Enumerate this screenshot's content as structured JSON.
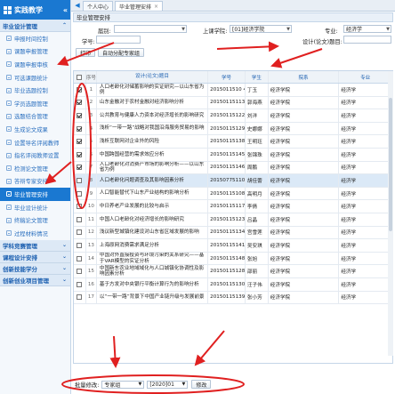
{
  "sidebar": {
    "app_title": "实践教学",
    "sections": [
      {
        "label": "毕业设计管理"
      },
      {
        "label": "学科竞赛管理"
      },
      {
        "label": "课程设计安排"
      },
      {
        "label": "创新技能学分"
      },
      {
        "label": "创新创业项目管理"
      }
    ],
    "items": [
      {
        "label": "申报时间控制"
      },
      {
        "label": "课题申报管理"
      },
      {
        "label": "课题申报审核"
      },
      {
        "label": "可选课题统计"
      },
      {
        "label": "毕业选题控制"
      },
      {
        "label": "学员选题管理"
      },
      {
        "label": "选题结合管理"
      },
      {
        "label": "生成论文成果"
      },
      {
        "label": "设置导名评阅教师"
      },
      {
        "label": "指名评阅教师设置"
      },
      {
        "label": "检测论文管理"
      },
      {
        "label": "答辩专家安排"
      },
      {
        "label": "毕业管理安排"
      },
      {
        "label": "毕业设计统计"
      },
      {
        "label": "终稿论文管理"
      },
      {
        "label": "过程材料情况"
      }
    ],
    "active_item": "毕业管理安排"
  },
  "topbar": {
    "tabs": [
      {
        "label": "个人中心"
      },
      {
        "label": "毕业管理安排"
      }
    ]
  },
  "main": {
    "panel_title": "毕业管理安排",
    "filters": {
      "grade_label": "届别:",
      "grade_value": "",
      "college_label": "上课学院:",
      "college_value": "[01]经济学院",
      "major_label": "专业:",
      "major_value": "经济学",
      "student_label": "学号:",
      "student_value": "",
      "topic_label": "设计(论文)题目:",
      "topic_value": ""
    },
    "toolbar": {
      "print_label": "打印",
      "auto_assign_label": "自动分配专家组"
    },
    "columns": {
      "no": "序号",
      "title": "设计(论文)题目",
      "student_id": "学号",
      "student": "学生",
      "dept": "院系",
      "major": "专业"
    },
    "rows": [
      {
        "no": "1",
        "title": "人口老龄化对储蓄影响的实证研究—以山东省为例",
        "id": "2015011510 4",
        "student": "丁玉",
        "dept": "经济学院",
        "major": "经济学",
        "checked": true
      },
      {
        "no": "2",
        "title": "山东金融对于农村金融对经济影响分析",
        "id": "20150115113",
        "student": "郭海燕",
        "dept": "经济学院",
        "major": "经济学",
        "checked": true
      },
      {
        "no": "3",
        "title": "公共教育与健康人力资本对经济增长的影响研究",
        "id": "20150115122",
        "student": "刘洋",
        "dept": "经济学院",
        "major": "经济学",
        "checked": true
      },
      {
        "no": "4",
        "title": "浅析“一带一路”战略对我国沿海服务贸易的影响",
        "id": "20150115129",
        "student": "史娜娜",
        "dept": "经济学院",
        "major": "经济学",
        "checked": true
      },
      {
        "no": "5",
        "title": "浅析互联网对企业外的风险",
        "id": "20150115138",
        "student": "王明珏",
        "dept": "经济学院",
        "major": "经济学",
        "checked": true
      },
      {
        "no": "6",
        "title": "中国跨国经营的需求效应分析",
        "id": "20150115145",
        "student": "张锦珠",
        "dept": "经济学院",
        "major": "经济学",
        "checked": true
      },
      {
        "no": "7",
        "title": "人口老龄化对消费产市场的影响分析——以山东省为例",
        "id": "20150115146",
        "student": "周鹏",
        "dept": "经济学院",
        "major": "经济学",
        "checked": true
      },
      {
        "no": "8",
        "title": "人口老龄化问题调查及其影响因素分析",
        "id": "20150775110",
        "student": "胡佳蕾",
        "dept": "经济学院",
        "major": "经济学",
        "checked": false
      },
      {
        "no": "9",
        "title": "人口智能替代下山东产业结构的影响分析",
        "id": "20150115108",
        "student": "高明月",
        "dept": "经济学院",
        "major": "经济学",
        "checked": false
      },
      {
        "no": "10",
        "title": "中日养老产业发展的比较与启示",
        "id": "20150115117",
        "student": "李倩",
        "dept": "经济学院",
        "major": "经济学",
        "checked": false
      },
      {
        "no": "11",
        "title": "中国人口老龄化对经济增长的影响研究",
        "id": "20150115123",
        "student": "吕晶",
        "dept": "经济学院",
        "major": "经济学",
        "checked": false
      },
      {
        "no": "12",
        "title": "浅议新型城镇化建设对山东省区域发展的影响",
        "id": "20150115134",
        "student": "宫雪莲",
        "dept": "经济学院",
        "major": "经济学",
        "checked": false
      },
      {
        "no": "13",
        "title": "上海原网消费需求满足分析",
        "id": "20150115141",
        "student": "吴安琪",
        "dept": "经济学院",
        "major": "经济学",
        "checked": false
      },
      {
        "no": "14",
        "title": "中国对外直接投资与环境污染的关系研究——基于VAR模型的实证分析",
        "id": "20150115148",
        "student": "张旭",
        "dept": "经济学院",
        "major": "经济学",
        "checked": false
      },
      {
        "no": "15",
        "title": "中国新东农业地域域化与人口城镇化协调性及影响因素分析",
        "id": "20150115128",
        "student": "邵丽",
        "dept": "经济学院",
        "major": "经济学",
        "checked": false
      },
      {
        "no": "16",
        "title": "基于方发对中央银行平衡计算行为的影响分析",
        "id": "20150115130",
        "student": "汪子伟",
        "dept": "经济学院",
        "major": "经济学",
        "checked": false
      },
      {
        "no": "17",
        "title": "以“一带一路”背景下中国产业链升级与发展前景",
        "id": "20150115139",
        "student": "张小芳",
        "dept": "经济学院",
        "major": "经济学",
        "checked": false
      }
    ]
  },
  "batch": {
    "label": "批量修改:",
    "expert_value": "专家组",
    "year_value": "[2020]01",
    "submit_label": "修改"
  },
  "colors": {
    "accent": "#1a78d1",
    "annotation": "#e02020"
  }
}
